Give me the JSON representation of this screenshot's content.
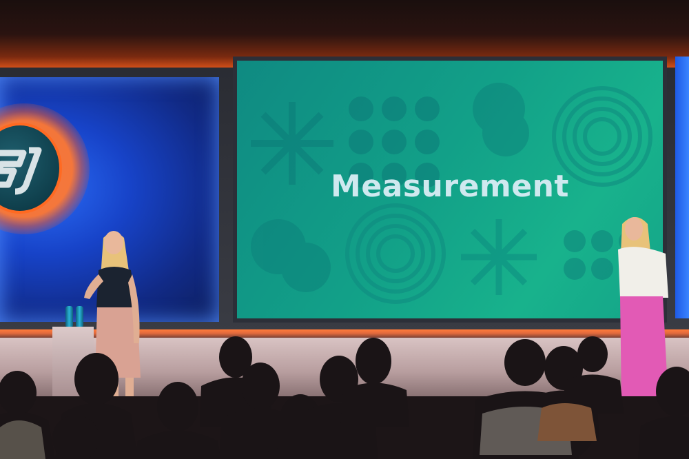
{
  "slide": {
    "title": "Measurement"
  },
  "colors": {
    "screen_teal": "#12a088",
    "panel_blue": "#1743c8",
    "stage_glow": "#ff7a2a",
    "slide_text": "#cfe9ef"
  }
}
